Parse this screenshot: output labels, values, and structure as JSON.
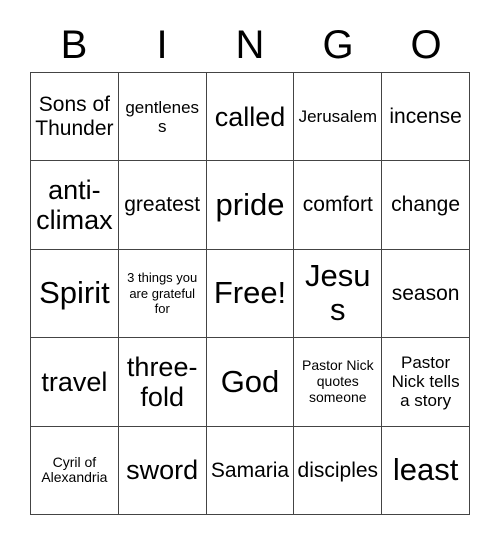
{
  "card": {
    "title_letters": [
      "B",
      "I",
      "N",
      "G",
      "O"
    ],
    "columns": 5,
    "rows": 5,
    "border_color": "#444444",
    "background_color": "#ffffff",
    "text_color": "#000000",
    "free_space": "Free!",
    "cells": [
      {
        "text": "Sons of Thunder",
        "size": "sz-md"
      },
      {
        "text": "gentleness",
        "size": "sz-sm"
      },
      {
        "text": "called",
        "size": "sz-lg"
      },
      {
        "text": "Jerusalem",
        "size": "sz-sm"
      },
      {
        "text": "incense",
        "size": "sz-md"
      },
      {
        "text": "anti-climax",
        "size": "sz-lg"
      },
      {
        "text": "greatest",
        "size": "sz-md"
      },
      {
        "text": "pride",
        "size": "sz-xl"
      },
      {
        "text": "comfort",
        "size": "sz-md"
      },
      {
        "text": "change",
        "size": "sz-md"
      },
      {
        "text": "Spirit",
        "size": "sz-xl"
      },
      {
        "text": "3 things you are grateful for",
        "size": "sz-xxs"
      },
      {
        "text": "Free!",
        "size": "sz-xl"
      },
      {
        "text": "Jesus",
        "size": "sz-xl"
      },
      {
        "text": "season",
        "size": "sz-md"
      },
      {
        "text": "travel",
        "size": "sz-lg"
      },
      {
        "text": "three-fold",
        "size": "sz-lg"
      },
      {
        "text": "God",
        "size": "sz-xl"
      },
      {
        "text": "Pastor Nick quotes someone",
        "size": "sz-xs"
      },
      {
        "text": "Pastor Nick tells a story",
        "size": "sz-sm"
      },
      {
        "text": "Cyril of Alexandria",
        "size": "sz-xs"
      },
      {
        "text": "sword",
        "size": "sz-lg"
      },
      {
        "text": "Samaria",
        "size": "sz-md"
      },
      {
        "text": "disciples",
        "size": "sz-md"
      },
      {
        "text": "least",
        "size": "sz-xl"
      }
    ]
  }
}
